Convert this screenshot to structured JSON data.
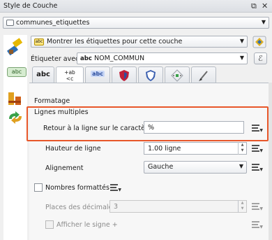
{
  "window": {
    "title": "Style de Couche",
    "float_icon": "restore-icon",
    "close_icon": "close-icon"
  },
  "layer_select": {
    "value": "communes_etiquettes"
  },
  "label_mode": {
    "value": "Montrer les étiquettes pour cette couche"
  },
  "label_with": {
    "label": "Étiqueter avec",
    "prefix": "abc",
    "value": "NOM_COMMUN",
    "expr_button": "ℰ"
  },
  "side_tab": {
    "label": "abc"
  },
  "tabs": [
    {
      "id": "text",
      "label": "abc",
      "icon": "text-icon"
    },
    {
      "id": "formatting",
      "label": "+ab <c",
      "icon": "formatting-icon"
    },
    {
      "id": "buffer",
      "label": "abc",
      "icon": "buffer-icon"
    },
    {
      "id": "background",
      "label": "",
      "icon": "background-shield-icon"
    },
    {
      "id": "shadow",
      "label": "",
      "icon": "shadow-icon"
    },
    {
      "id": "placement",
      "label": "",
      "icon": "placement-icon"
    },
    {
      "id": "rendering",
      "label": "",
      "icon": "rendering-brush-icon"
    }
  ],
  "formatting": {
    "heading": "Formatage",
    "multiline": {
      "heading": "Lignes multiples",
      "wrap_label": "Retour à la ligne sur le caractère",
      "wrap_value": "%",
      "line_height_label": "Hauteur de ligne",
      "line_height_value": "1.00 ligne",
      "alignment_label": "Alignement",
      "alignment_value": "Gauche"
    },
    "numbers": {
      "checkbox_label": "Nombres formattés",
      "decimals_label": "Places des décimales",
      "decimals_value": "3",
      "sign_label": "Afficher le signe +"
    }
  },
  "colors": {
    "highlight": "#e8572a",
    "background_shield": "#c0213a",
    "shadow_icon": "#3a5fb0",
    "placement_icon": "#3aa14a"
  }
}
